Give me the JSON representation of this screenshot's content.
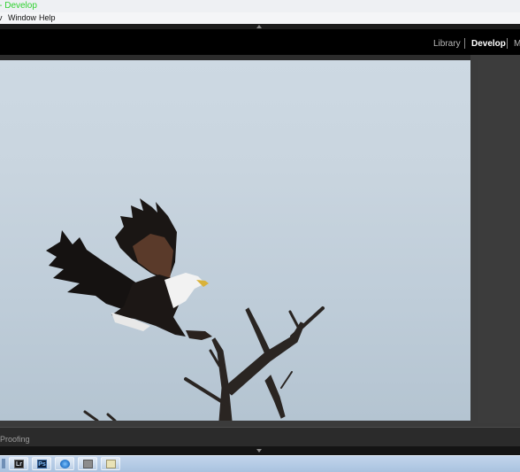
{
  "app": {
    "title": "m - Develop"
  },
  "menubar": {
    "items": [
      {
        "label": "v"
      },
      {
        "label": "Window"
      },
      {
        "label": "Help"
      }
    ]
  },
  "modules": {
    "items": [
      {
        "label": "Library",
        "active": false
      },
      {
        "label": "Develop",
        "active": true
      },
      {
        "label": "M",
        "active": false
      }
    ]
  },
  "toolbar": {
    "proofing_label": "Proofing"
  },
  "taskbar": {
    "buttons": [
      {
        "icon": "lightroom-icon",
        "text": "Lr"
      },
      {
        "icon": "photoshop-icon",
        "text": "Ps"
      },
      {
        "icon": "browser-icon",
        "text": ""
      },
      {
        "icon": "folder-icon",
        "text": ""
      },
      {
        "icon": "notepad-icon",
        "text": ""
      }
    ]
  },
  "colors": {
    "title_text": "#2fd12f",
    "module_active": "#ffffff",
    "module_inactive": "#b8b8b8",
    "panel_bg": "#3b3b3b",
    "sky": "#c9d5df"
  }
}
